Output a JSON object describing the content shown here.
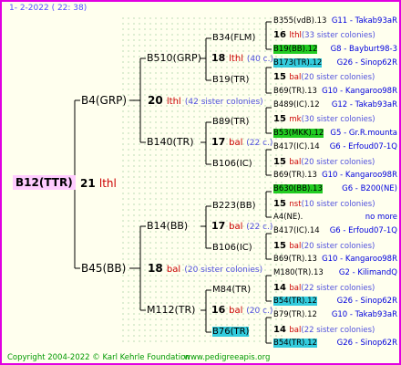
{
  "header": {
    "date": "1-   2-2022 ( 22:  38)"
  },
  "footer": {
    "copyright": "Copyright 2004-2022 © Karl Kehrle Foundation",
    "site": "www.pedigreeapis.org"
  },
  "root": {
    "id": "B12(TTR)",
    "num": "21",
    "mark": "lthl"
  },
  "gen1": [
    {
      "id": "B4(GRP)",
      "num": "20",
      "mark": "lthl",
      "colonies": "(42 sister colonies)"
    },
    {
      "id": "B45(BB)",
      "num": "18",
      "mark": "bal",
      "colonies": "(20 sister colonies)"
    }
  ],
  "gen2": [
    {
      "id": "B510(GRP)",
      "num": "18",
      "mark": "lthl",
      "colonies": "(40 c.)"
    },
    {
      "id": "B140(TR)",
      "num": "17",
      "mark": "bal",
      "colonies": "(22 c.)"
    },
    {
      "id": "B14(BB)",
      "num": "17",
      "mark": "bal",
      "colonies": "(22 c.)"
    },
    {
      "id": "M112(TR)",
      "num": "16",
      "mark": "bal",
      "colonies": "(20 c.)"
    }
  ],
  "gen3": [
    {
      "id": "B34(FLM)",
      "num": "18",
      "mark": "lthl",
      "colonies": "(40 c.)"
    },
    {
      "id": "B19(TR)"
    },
    {
      "id": "B89(TR)",
      "num": "17",
      "mark": "bal",
      "colonies": "(22 c.)"
    },
    {
      "id": "B106(IC)"
    },
    {
      "id": "B223(BB)",
      "num": "17",
      "mark": "bal",
      "colonies": "(22 c.)"
    },
    {
      "id": "B106(IC)"
    },
    {
      "id": "M84(TR)",
      "num": "16",
      "mark": "bal",
      "colonies": "(20 c.)"
    },
    {
      "id": "B76(TR)"
    }
  ],
  "gen4": [
    {
      "text": "B355(vdB).13",
      "meta": "G11 - Takab93aR",
      "hl": ""
    },
    {
      "text": "16",
      "mark": "lthl",
      "colonies": "(33 sister colonies)",
      "type": "num"
    },
    {
      "text": "B19(BB).12",
      "meta": "G8 - Bayburt98-3",
      "hl": "g"
    },
    {
      "text": "B173(TR).12",
      "meta": "G26 - Sinop62R",
      "hl": "c"
    },
    {
      "text": "15",
      "mark": "bal",
      "colonies": "(20 sister colonies)",
      "type": "num"
    },
    {
      "text": "B69(TR).13",
      "meta": "G10 - Kangaroo98R",
      "hl": ""
    },
    {
      "text": "B489(IC).12",
      "meta": "G12 - Takab93aR",
      "hl": ""
    },
    {
      "text": "15",
      "mark": "mk",
      "colonies": "(30 sister colonies)",
      "type": "num"
    },
    {
      "text": "B53(MKK).12",
      "meta": "G5 - Gr.R.mounta",
      "hl": "g"
    },
    {
      "text": "B417(IC).14",
      "meta": "G6 - Erfoud07-1Q",
      "hl": ""
    },
    {
      "text": "15",
      "mark": "bal",
      "colonies": "(20 sister colonies)",
      "type": "num"
    },
    {
      "text": "B69(TR).13",
      "meta": "G10 - Kangaroo98R",
      "hl": ""
    },
    {
      "text": "B630(BB).13",
      "meta": "G6 - B200(NE)",
      "hl": "g"
    },
    {
      "text": "15",
      "mark": "nst",
      "colonies": "(10 sister colonies)",
      "type": "num"
    },
    {
      "text": "A4(NE).",
      "meta": "no more",
      "hl": ""
    },
    {
      "text": "B417(IC).14",
      "meta": "G6 - Erfoud07-1Q",
      "hl": ""
    },
    {
      "text": "15",
      "mark": "bal",
      "colonies": "(20 sister colonies)",
      "type": "num"
    },
    {
      "text": "B69(TR).13",
      "meta": "G10 - Kangaroo98R",
      "hl": ""
    },
    {
      "text": "M180(TR).13",
      "meta": "G2 - KilimandQ",
      "hl": ""
    },
    {
      "text": "14",
      "mark": "bal",
      "colonies": "(22 sister colonies)",
      "type": "num"
    },
    {
      "text": "B54(TR).12",
      "meta": "G26 - Sinop62R",
      "hl": "c"
    },
    {
      "text": "B79(TR).12",
      "meta": "G10 - Takab93aR",
      "hl": ""
    },
    {
      "text": "14",
      "mark": "bal",
      "colonies": "(22 sister colonies)",
      "type": "num"
    },
    {
      "text": "B54(TR).12",
      "meta": "G26 - Sinop62R",
      "hl": "c"
    }
  ]
}
